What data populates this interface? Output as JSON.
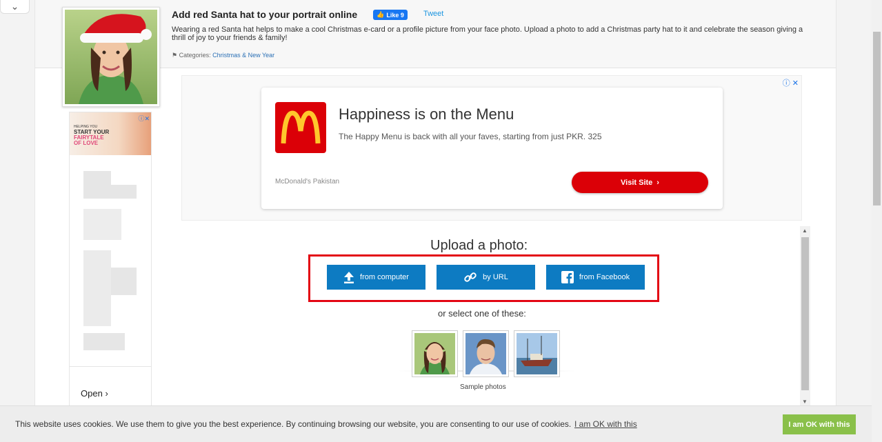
{
  "header": {
    "title": "Add red Santa hat to your portrait online",
    "like_label": "Like 9",
    "tweet_label": "Tweet",
    "description": "Wearing a red Santa hat helps to make a cool Christmas e-card or a profile picture from your face photo. Upload a photo to add a Christmas party hat to it and celebrate the season giving a thrill of joy to your friends & family!",
    "categories_label": "Categories:",
    "category_link": "Christmas & New Year"
  },
  "side_ad": {
    "line1": "HELPING YOU",
    "line2": "START YOUR",
    "line3": "FAIRYTALE",
    "line4": "OF LOVE",
    "open_label": "Open"
  },
  "ad": {
    "headline": "Happiness is on the Menu",
    "subtext": "The Happy Menu is back with all your faves, starting from just PKR. 325",
    "advertiser": "McDonald's Pakistan",
    "cta": "Visit Site"
  },
  "upload": {
    "title": "Upload a photo:",
    "buttons": [
      {
        "label": "from computer",
        "icon": "upload-icon"
      },
      {
        "label": "by URL",
        "icon": "link-icon"
      },
      {
        "label": "from Facebook",
        "icon": "facebook-icon"
      }
    ],
    "or_select": "or select one of these:",
    "samples_caption": "Sample photos"
  },
  "cookie": {
    "text": "This website uses cookies. We use them to give you the best experience. By continuing browsing our website, you are consenting to our use of cookies.",
    "link": "I am OK with this",
    "button": "I am OK with this"
  },
  "colors": {
    "accent_blue": "#0d7bc2",
    "highlight_red": "#e30613",
    "mcd_red": "#db0007",
    "cookie_green": "#8ac04a"
  }
}
